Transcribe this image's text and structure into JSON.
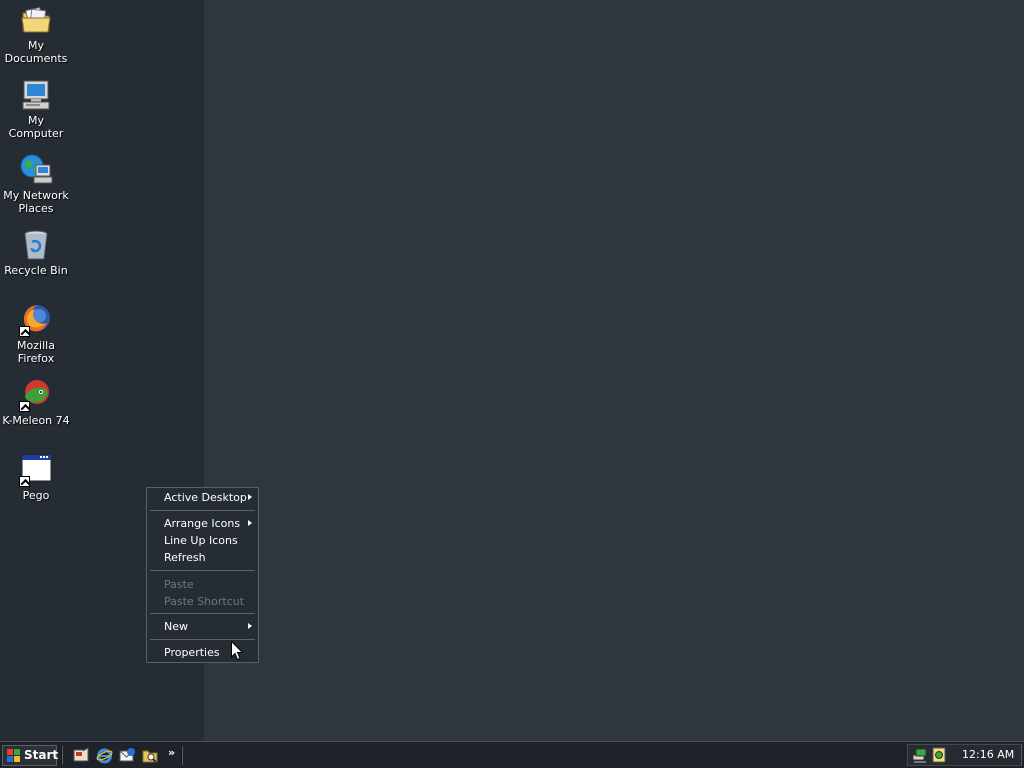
{
  "desktop": {
    "icons": [
      {
        "label": "My Documents",
        "icon": "folder-documents-icon"
      },
      {
        "label": "My Computer",
        "icon": "computer-icon"
      },
      {
        "label": "My Network",
        "label2": "Places",
        "icon": "network-places-icon"
      },
      {
        "label": "Recycle Bin",
        "icon": "recycle-bin-icon"
      },
      {
        "label": "Mozilla Firefox",
        "icon": "firefox-icon"
      },
      {
        "label": "K-Meleon 74",
        "icon": "k-meleon-icon"
      },
      {
        "label": "Pego",
        "icon": "window-app-icon"
      }
    ],
    "colors": {
      "background": "#30363e",
      "icon_column": "#262c33"
    }
  },
  "context_menu": {
    "items": [
      {
        "label": "Active Desktop",
        "submenu": true,
        "enabled": true
      },
      {
        "label": "Arrange Icons",
        "submenu": true,
        "enabled": true
      },
      {
        "label": "Line Up Icons",
        "submenu": false,
        "enabled": true
      },
      {
        "label": "Refresh",
        "submenu": false,
        "enabled": true
      },
      {
        "label": "Paste",
        "submenu": false,
        "enabled": false
      },
      {
        "label": "Paste Shortcut",
        "submenu": false,
        "enabled": false
      },
      {
        "label": "New",
        "submenu": true,
        "enabled": true
      },
      {
        "label": "Properties",
        "submenu": false,
        "enabled": true
      }
    ]
  },
  "taskbar": {
    "start_label": "Start",
    "quick_launch": [
      "show-desktop-icon",
      "internet-explorer-icon",
      "outlook-express-icon",
      "windows-explorer-icon"
    ],
    "chevron": "»",
    "tray": {
      "icons": [
        "network-tray-icon",
        "volume-tray-icon"
      ],
      "clock": "12:16 AM"
    }
  }
}
